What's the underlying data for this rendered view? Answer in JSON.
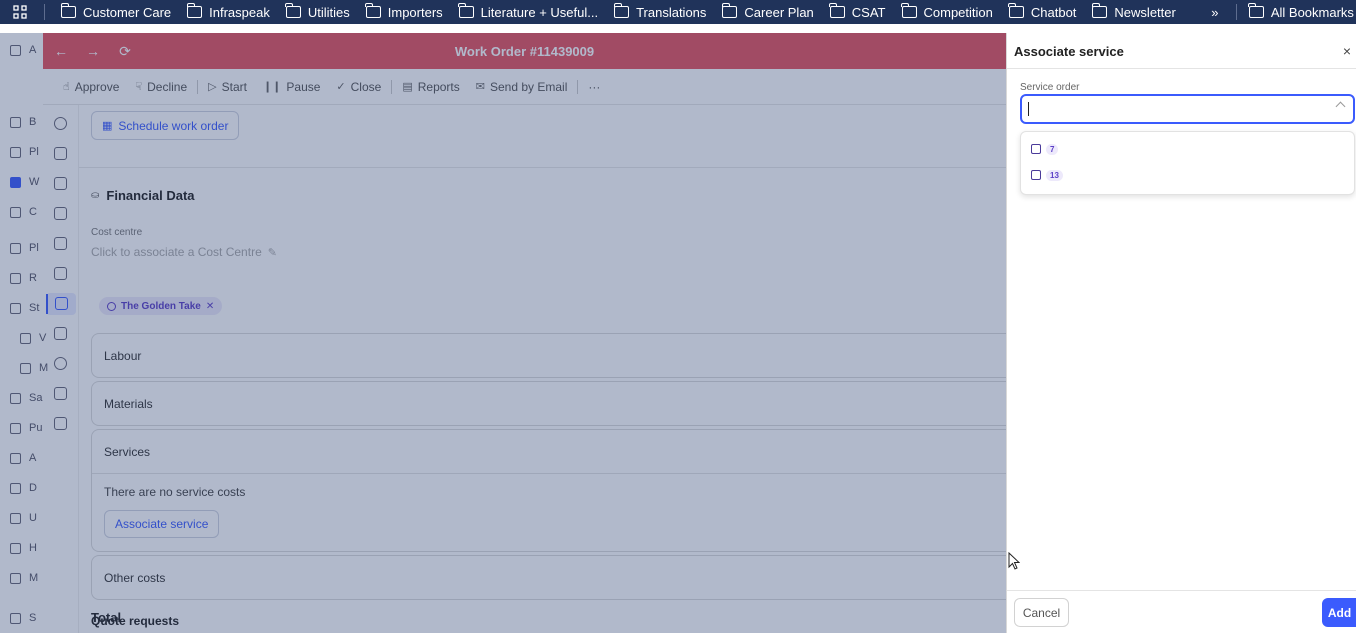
{
  "bookmarks": {
    "items": [
      "Customer Care",
      "Infraspeak",
      "Utilities",
      "Importers",
      "Literature + Useful...",
      "Translations",
      "Career Plan",
      "CSAT",
      "Competition",
      "Chatbot",
      "Newsletter"
    ],
    "more": "»",
    "all": "All Bookmarks"
  },
  "work_order": {
    "title": "Work Order #11439009",
    "toolbar": [
      "Approve",
      "Decline",
      "Start",
      "Pause",
      "Close",
      "Reports",
      "Send by Email"
    ],
    "more": "···",
    "schedule_button": "Schedule work order",
    "financial_title": "Financial Data",
    "cost_centre_label": "Cost centre",
    "cost_centre_placeholder": "Click to associate a Cost Centre",
    "chip": "The Golden Take",
    "chip_remove": "✕",
    "sections": {
      "labour": "Labour",
      "materials": "Materials",
      "services": "Services",
      "services_empty": "There are no service costs",
      "associate_service": "Associate service",
      "other": "Other costs"
    },
    "total": "Total",
    "quote_requests": "Quote requests"
  },
  "left_nav": {
    "items": [
      "A",
      "B",
      "Pl",
      "W",
      "C",
      "Pl",
      "R",
      "St",
      "V",
      "M",
      "Sa",
      "Pu",
      "A",
      "D",
      "U",
      "H",
      "M",
      "S"
    ]
  },
  "panel": {
    "title": "Associate service",
    "close": "×",
    "field_label": "Service order",
    "options": [
      "7",
      "13"
    ],
    "cancel": "Cancel",
    "add": "Add"
  },
  "colors": {
    "header_red": "#e6545e",
    "accent_blue": "#3b5bfd",
    "bookmark_bar": "#20335a",
    "chip_purple": "#5b3fc7"
  }
}
